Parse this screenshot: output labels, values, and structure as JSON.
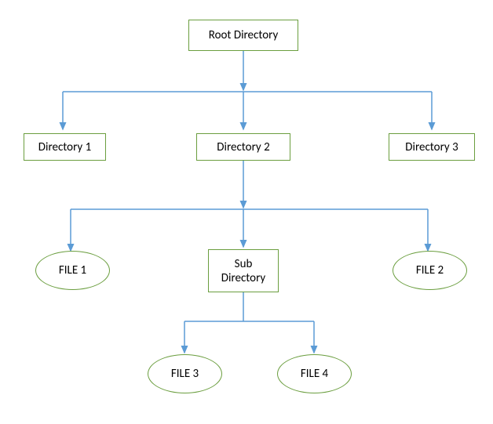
{
  "diagram": {
    "root": {
      "label": "Root Directory"
    },
    "level1": {
      "dir1": {
        "label": "Directory 1"
      },
      "dir2": {
        "label": "Directory 2"
      },
      "dir3": {
        "label": "Directory 3"
      }
    },
    "level2": {
      "file1": {
        "label": "FILE 1"
      },
      "subdir": {
        "label": "Sub Directory"
      },
      "file2": {
        "label": "FILE 2"
      }
    },
    "level3": {
      "file3": {
        "label": "FILE 3"
      },
      "file4": {
        "label": "FILE 4"
      }
    }
  },
  "colors": {
    "box_border": "#6b9e3f",
    "connector": "#5b9bd5"
  }
}
